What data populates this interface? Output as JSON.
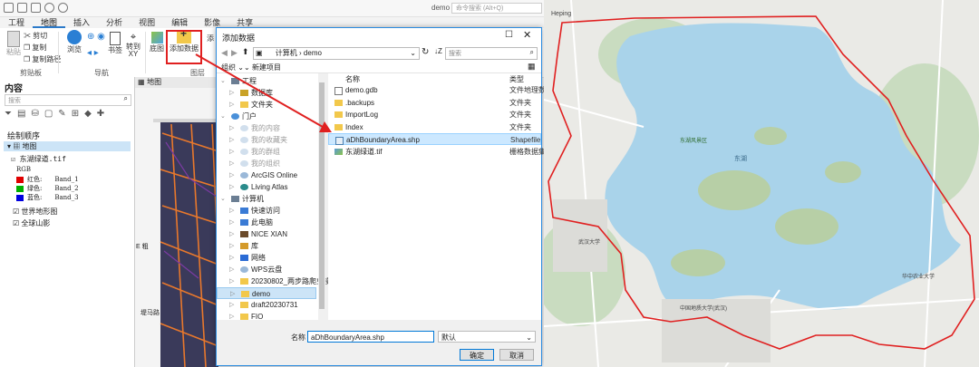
{
  "app": {
    "doc_title": "demo",
    "search_placeholder": "命令搜索 (Alt+Q)",
    "ribbon_tabs": [
      "工程",
      "地图",
      "插入",
      "分析",
      "视图",
      "编辑",
      "影像",
      "共享"
    ],
    "clipboard": {
      "paste": "粘贴",
      "cut": "剪切",
      "copy": "复制",
      "copy_path": "复制路径",
      "group_label": "剪贴板"
    },
    "nav": {
      "explore": "浏览",
      "bookmark": "书签",
      "goto_xy": "转到\nXY",
      "group_label": "导航"
    },
    "layer": {
      "basemap": "底图",
      "add_data": "添加数据",
      "group_label": "图层",
      "extra": "添"
    },
    "accent_color": "#2c7ac9"
  },
  "contents": {
    "title": "内容",
    "search_placeholder": "搜索",
    "drawing_order": "绘制顺序",
    "map_name": "地图",
    "layers": [
      {
        "name": "东湖绿道.tif",
        "checked": true
      },
      {
        "name": "世界地形图",
        "checked": true
      },
      {
        "name": "全球山影",
        "checked": true
      }
    ],
    "rgb_label": "RGB",
    "bands": [
      {
        "label": "红色:",
        "band": "Band_1",
        "color": "#e00000"
      },
      {
        "label": "绿色:",
        "band": "Band_2",
        "color": "#00b000"
      },
      {
        "label": "蓝色:",
        "band": "Band_3",
        "color": "#0000e0"
      }
    ]
  },
  "map_view": {
    "tab": "地图",
    "label_1": "E 粗",
    "label_2": "堤马路"
  },
  "dialog": {
    "title": "添加数据",
    "breadcrumb": [
      "计算机",
      "demo"
    ],
    "search_placeholder": "搜索",
    "organize": "组织",
    "new_item": "新建项目",
    "col_name": "名称",
    "col_type": "类型",
    "tree": [
      {
        "label": "工程",
        "level": 0,
        "dim": false,
        "icon": "project-icon"
      },
      {
        "label": "数据库",
        "level": 1,
        "dim": false,
        "icon": "database-icon"
      },
      {
        "label": "文件夹",
        "level": 1,
        "dim": false,
        "icon": "folder-icon"
      },
      {
        "label": "门户",
        "level": 0,
        "dim": false,
        "icon": "portal-icon"
      },
      {
        "label": "我的内容",
        "level": 1,
        "dim": true,
        "icon": "cloud-icon"
      },
      {
        "label": "我的收藏夹",
        "level": 1,
        "dim": true,
        "icon": "cloud-icon"
      },
      {
        "label": "我的群组",
        "level": 1,
        "dim": true,
        "icon": "cloud-icon"
      },
      {
        "label": "我的组织",
        "level": 1,
        "dim": true,
        "icon": "cloud-icon"
      },
      {
        "label": "ArcGIS Online",
        "level": 1,
        "dim": false,
        "icon": "cloud-icon"
      },
      {
        "label": "Living Atlas",
        "level": 1,
        "dim": false,
        "icon": "globe-icon"
      },
      {
        "label": "计算机",
        "level": 0,
        "dim": false,
        "icon": "computer-icon"
      },
      {
        "label": "快速访问",
        "level": 1,
        "dim": false,
        "icon": "star-icon"
      },
      {
        "label": "此电脑",
        "level": 1,
        "dim": false,
        "icon": "pc-icon"
      },
      {
        "label": "NICE XIAN",
        "level": 1,
        "dim": false,
        "icon": "user-icon"
      },
      {
        "label": "库",
        "level": 1,
        "dim": false,
        "icon": "library-icon"
      },
      {
        "label": "网络",
        "level": 1,
        "dim": false,
        "icon": "network-icon"
      },
      {
        "label": "WPS云盘",
        "level": 1,
        "dim": false,
        "icon": "cloud-icon"
      },
      {
        "label": "20230802_两步路爬虫操",
        "level": 1,
        "dim": false,
        "icon": "folder-icon"
      },
      {
        "label": "demo",
        "level": 1,
        "dim": false,
        "icon": "folder-icon",
        "selected": true
      },
      {
        "label": "draft20230731",
        "level": 1,
        "dim": false,
        "icon": "folder-icon"
      },
      {
        "label": "FIO",
        "level": 1,
        "dim": false,
        "icon": "folder-icon"
      }
    ],
    "files": [
      {
        "name": "demo.gdb",
        "type": "文件地理数",
        "icon": "gdb-icon"
      },
      {
        "name": ".backups",
        "type": "文件夹",
        "icon": "folder-icon"
      },
      {
        "name": "ImportLog",
        "type": "文件夹",
        "icon": "folder-icon"
      },
      {
        "name": "Index",
        "type": "文件夹",
        "icon": "folder-icon"
      },
      {
        "name": "aDhBoundaryArea.shp",
        "type": "Shapefile",
        "icon": "shapefile-icon",
        "selected": true
      },
      {
        "name": "东湖绿道.tif",
        "type": "栅格数据集",
        "icon": "raster-icon"
      }
    ],
    "name_label": "名称",
    "name_value": "aDhBoundaryArea.shp",
    "filter_value": "默认",
    "ok": "确定",
    "cancel": "取消"
  },
  "map_right": {
    "labels": [
      "Heping",
      "东湖",
      "武汉大学",
      "中国地质大学(武汉)",
      "东湖风景区",
      "华中农业大学"
    ]
  }
}
